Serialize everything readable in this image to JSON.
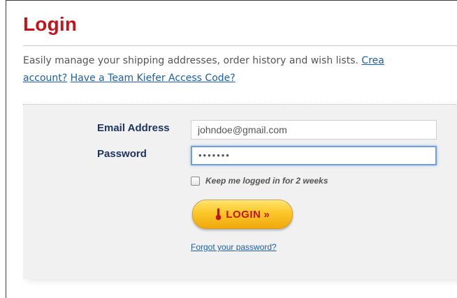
{
  "page": {
    "title": "Login"
  },
  "intro": {
    "text": "Easily manage your shipping addresses, order history and wish lists. ",
    "create_link_part1": "Crea",
    "create_link_part2": "account?",
    "access_code_link": "Have a Team Kiefer Access Code?"
  },
  "form": {
    "email_label": "Email Address",
    "email_value": "johndoe@gmail.com",
    "password_label": "Password",
    "password_value": "•••••••",
    "remember_label": "Keep me logged in for 2 weeks",
    "login_label": "LOGIN",
    "login_chevron": "»",
    "forgot_link": "Forgot your password?"
  },
  "colors": {
    "title_red": "#c4141b",
    "link_blue": "#1d5fa8",
    "label_navy": "#1e3560",
    "button_yellow": "#fcc72a"
  },
  "icons": {
    "login_button_icon": "thermometer-icon",
    "remember_checkbox": "checkbox-icon"
  }
}
